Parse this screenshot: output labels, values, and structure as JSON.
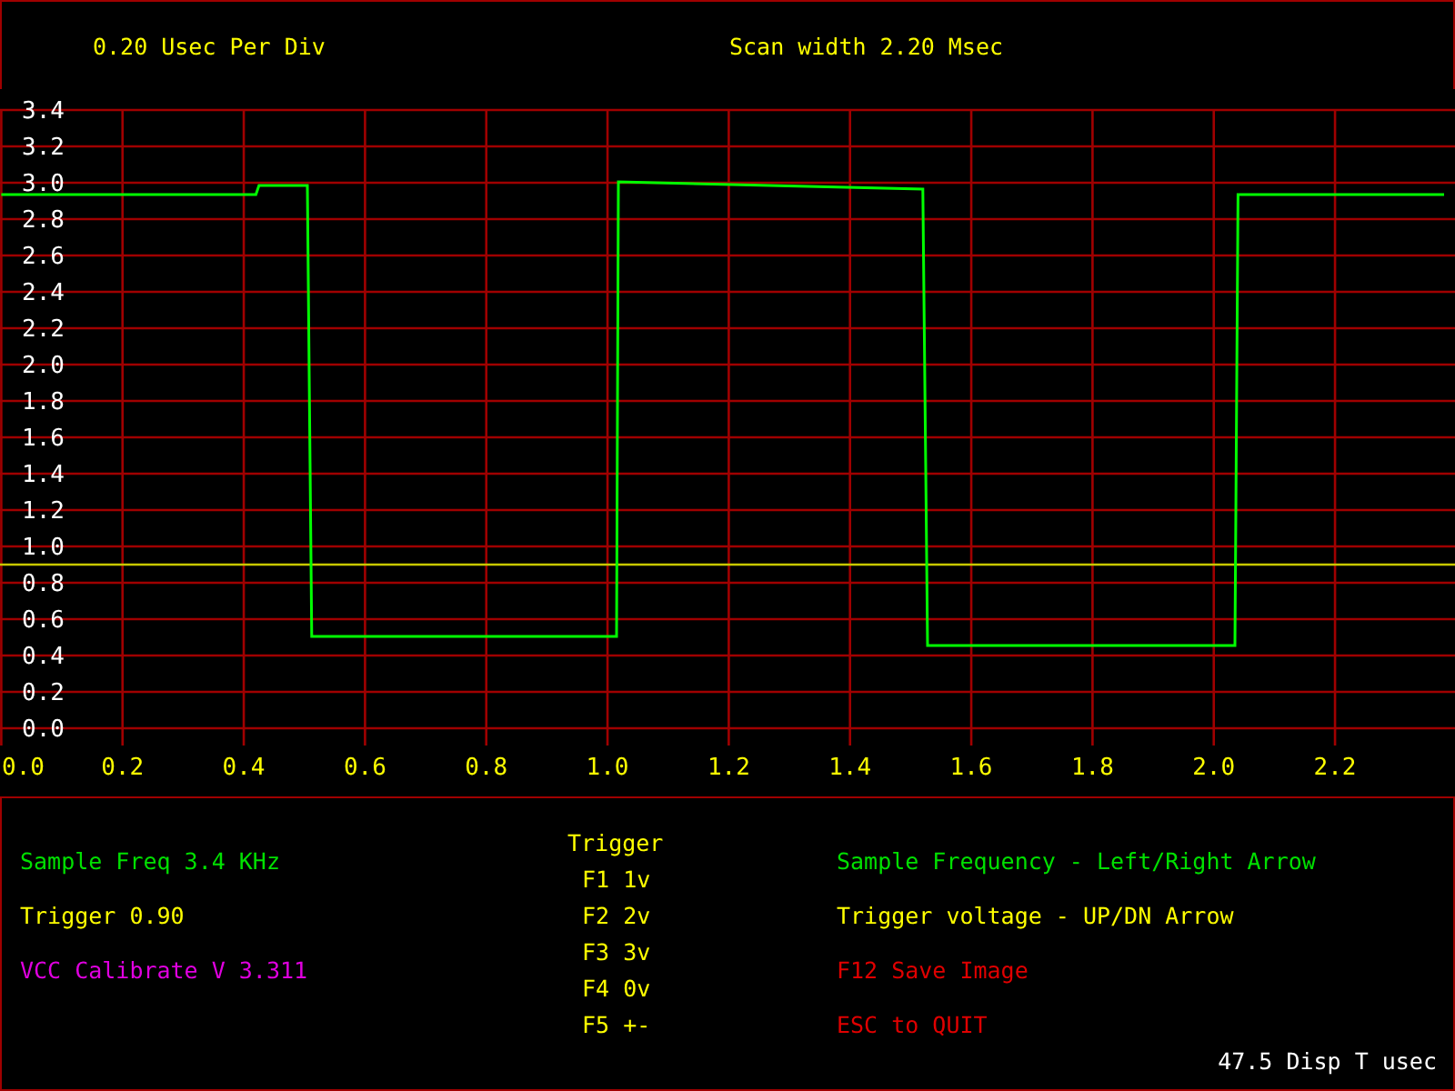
{
  "header": {
    "scale": "0.20 Usec Per Div",
    "scan_width": "Scan width 2.20 Msec"
  },
  "scope": {
    "chart_data": {
      "type": "line",
      "x": [
        0,
        0.42,
        0.425,
        0.505,
        0.512,
        1.015,
        1.018,
        1.52,
        1.528,
        2.035,
        2.04,
        2.38
      ],
      "series": [
        {
          "color": "#00ff00",
          "values": [
            2.93,
            2.93,
            2.98,
            2.98,
            0.5,
            0.5,
            3.0,
            2.96,
            0.45,
            0.45,
            2.93,
            2.93
          ]
        }
      ],
      "grid": true,
      "xlim": [
        0,
        2.4
      ],
      "ylim": [
        -0.1,
        3.4
      ],
      "xticks": [
        {
          "value": 0,
          "label": "0.0"
        },
        {
          "value": 0.2,
          "label": "0.2"
        },
        {
          "value": 0.4,
          "label": "0.4"
        },
        {
          "value": 0.6,
          "label": "0.6"
        },
        {
          "value": 0.8,
          "label": "0.8"
        },
        {
          "value": 1.0,
          "label": "1.0"
        },
        {
          "value": 1.2,
          "label": "1.2"
        },
        {
          "value": 1.4,
          "label": "1.4"
        },
        {
          "value": 1.6,
          "label": "1.6"
        },
        {
          "value": 1.8,
          "label": "1.8"
        },
        {
          "value": 2.0,
          "label": "2.0"
        },
        {
          "value": 2.2,
          "label": "2.2"
        }
      ],
      "yticks": [
        {
          "value": 3.4,
          "label": "3.4"
        },
        {
          "value": 3.2,
          "label": "3.2"
        },
        {
          "value": 3.0,
          "label": "3.0"
        },
        {
          "value": 2.8,
          "label": "2.8"
        },
        {
          "value": 2.6,
          "label": "2.6"
        },
        {
          "value": 2.4,
          "label": "2.4"
        },
        {
          "value": 2.2,
          "label": "2.2"
        },
        {
          "value": 2.0,
          "label": "2.0"
        },
        {
          "value": 1.8,
          "label": "1.8"
        },
        {
          "value": 1.6,
          "label": "1.6"
        },
        {
          "value": 1.4,
          "label": "1.4"
        },
        {
          "value": 1.2,
          "label": "1.2"
        },
        {
          "value": 1.0,
          "label": "1.0"
        },
        {
          "value": 0.8,
          "label": "0.8"
        },
        {
          "value": 0.6,
          "label": "0.6"
        },
        {
          "value": 0.4,
          "label": "0.4"
        },
        {
          "value": 0.2,
          "label": "0.2"
        },
        {
          "value": 0,
          "label": "0.0"
        }
      ],
      "ref_lines": [
        {
          "axis": "y",
          "value": 0.9,
          "color": "#c8c800"
        }
      ]
    }
  },
  "panel": {
    "status": [
      {
        "text": "Sample Freq 3.4 KHz",
        "color": "#00e000"
      },
      {
        "text": "Trigger 0.90",
        "color": "#ffff00"
      },
      {
        "text": "VCC Calibrate V 3.311",
        "color": "#e000e0"
      }
    ],
    "trigger_keys": {
      "title": "Trigger",
      "items": [
        "F1 1v",
        "F2 2v",
        "F3 3v",
        "F4 0v",
        "F5 +-"
      ]
    },
    "help": [
      {
        "text": "Sample Frequency - Left/Right Arrow",
        "color": "#00e000"
      },
      {
        "text": "Trigger voltage - UP/DN Arrow",
        "color": "#ffff00"
      },
      {
        "text": "F12 Save Image",
        "color": "#e00000"
      },
      {
        "text": "ESC to QUIT",
        "color": "#e00000"
      }
    ],
    "display_time": "47.5 Disp T usec"
  }
}
